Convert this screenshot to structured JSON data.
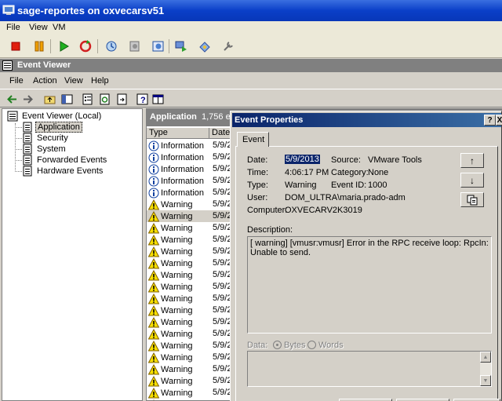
{
  "vm_window": {
    "title": "sage-reportes on oxvecarsv51",
    "menu": [
      "File",
      "View",
      "VM"
    ]
  },
  "event_viewer": {
    "title": "Event Viewer",
    "menu": [
      "File",
      "Action",
      "View",
      "Help"
    ]
  },
  "tree": {
    "root": "Event Viewer (Local)",
    "items": [
      "Application",
      "Security",
      "System",
      "Forwarded Events",
      "Hardware Events"
    ],
    "selected": "Application"
  },
  "list": {
    "header_title": "Application",
    "header_count": "1,756 ev",
    "columns": [
      "Type",
      "Date"
    ],
    "rows": [
      {
        "type": "Information",
        "date": "5/9/2",
        "icon": "information-icon"
      },
      {
        "type": "Information",
        "date": "5/9/2",
        "icon": "information-icon"
      },
      {
        "type": "Information",
        "date": "5/9/2",
        "icon": "information-icon"
      },
      {
        "type": "Information",
        "date": "5/9/2",
        "icon": "information-icon"
      },
      {
        "type": "Information",
        "date": "5/9/2",
        "icon": "information-icon"
      },
      {
        "type": "Warning",
        "date": "5/9/2",
        "icon": "warning-icon"
      },
      {
        "type": "Warning",
        "date": "5/9/2",
        "icon": "warning-icon",
        "selected": true
      },
      {
        "type": "Warning",
        "date": "5/9/2",
        "icon": "warning-icon"
      },
      {
        "type": "Warning",
        "date": "5/9/2",
        "icon": "warning-icon"
      },
      {
        "type": "Warning",
        "date": "5/9/2",
        "icon": "warning-icon"
      },
      {
        "type": "Warning",
        "date": "5/9/2",
        "icon": "warning-icon"
      },
      {
        "type": "Warning",
        "date": "5/9/2",
        "icon": "warning-icon"
      },
      {
        "type": "Warning",
        "date": "5/9/2",
        "icon": "warning-icon"
      },
      {
        "type": "Warning",
        "date": "5/9/2",
        "icon": "warning-icon"
      },
      {
        "type": "Warning",
        "date": "5/9/2",
        "icon": "warning-icon"
      },
      {
        "type": "Warning",
        "date": "5/9/2",
        "icon": "warning-icon"
      },
      {
        "type": "Warning",
        "date": "5/9/2",
        "icon": "warning-icon"
      },
      {
        "type": "Warning",
        "date": "5/9/2",
        "icon": "warning-icon"
      },
      {
        "type": "Warning",
        "date": "5/9/2",
        "icon": "warning-icon"
      },
      {
        "type": "Warning",
        "date": "5/9/2",
        "icon": "warning-icon"
      },
      {
        "type": "Warning",
        "date": "5/9/2",
        "icon": "warning-icon"
      },
      {
        "type": "Warning",
        "date": "5/9/2",
        "icon": "warning-icon"
      },
      {
        "type": "Warning",
        "date": "5/9/2",
        "icon": "warning-icon"
      }
    ]
  },
  "dialog": {
    "title": "Event Properties",
    "help_btn": "?",
    "close_btn": "X",
    "tab": "Event",
    "labels": {
      "date": "Date:",
      "source": "Source:",
      "time": "Time:",
      "category": "Category:",
      "type": "Type:",
      "event_id": "Event ID:",
      "user": "User:",
      "computer": "Computer:",
      "description": "Description:",
      "data": "Data:",
      "bytes": "Bytes",
      "words": "Words"
    },
    "values": {
      "date": "5/9/2013",
      "source": "VMware Tools",
      "time": "4:06:17 PM",
      "category": "None",
      "type": "Warning",
      "event_id": "1000",
      "user": "DOM_ULTRA\\maria.prado-adm",
      "computer": "OXVECARV2K3019"
    },
    "description_text": "[ warning] [vmusr:vmusr] Error in the RPC receive loop: RpcIn: Unable to send.",
    "data_format_selected": "Bytes",
    "nav": {
      "up": "↑",
      "down": "↓"
    }
  },
  "colors": {
    "xp_title": "#0a3fc8",
    "dialog_title": "#0a246a",
    "face": "#d4d0c8"
  }
}
